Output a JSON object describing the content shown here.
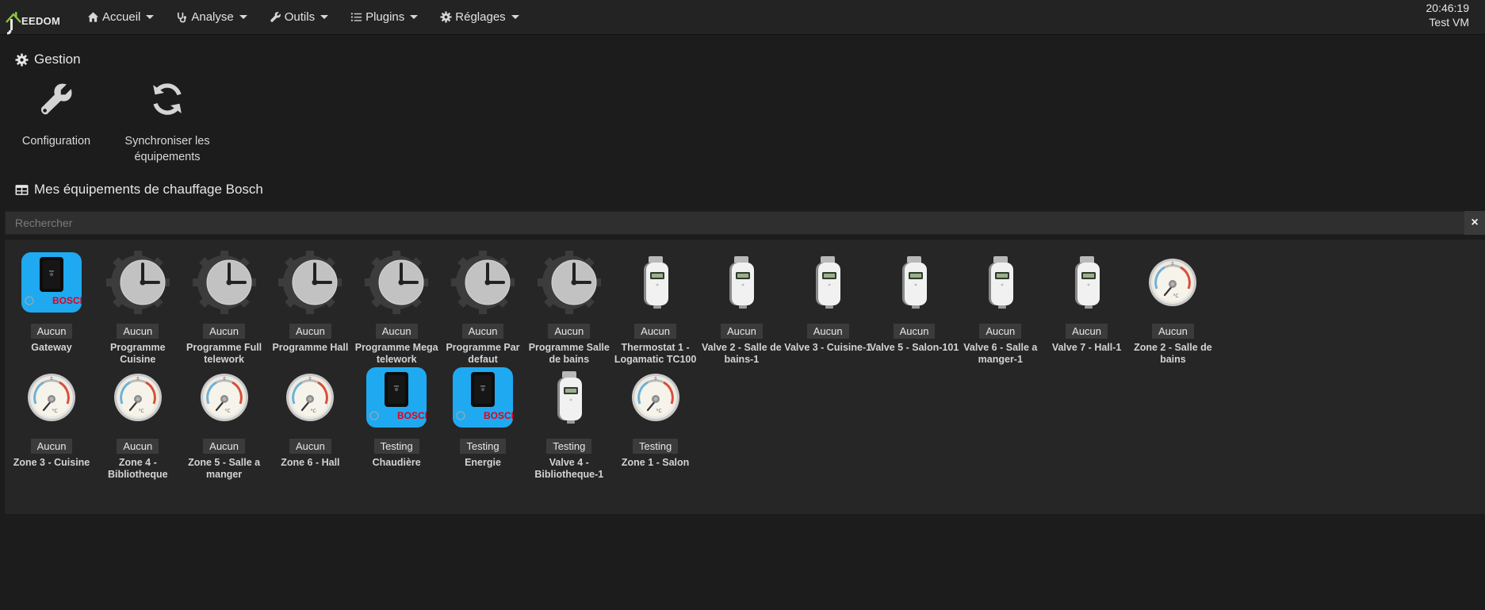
{
  "app": {
    "logo_text": "EEDOM"
  },
  "nav": {
    "items": [
      {
        "label": "Accueil",
        "icon": "home-icon"
      },
      {
        "label": "Analyse",
        "icon": "stethoscope-icon"
      },
      {
        "label": "Outils",
        "icon": "wrench-icon"
      },
      {
        "label": "Plugins",
        "icon": "list-icon"
      },
      {
        "label": "Réglages",
        "icon": "gear-icon"
      }
    ],
    "clock": "20:46:19",
    "host": "Test VM"
  },
  "gestion": {
    "title": "Gestion",
    "items": [
      {
        "label": "Configuration",
        "icon": "wrench-icon"
      },
      {
        "label": "Synchroniser les équipements",
        "icon": "refresh-icon"
      }
    ]
  },
  "equipements": {
    "title": "Mes équipements de chauffage Bosch",
    "search_placeholder": "Rechercher",
    "clear_label": "×",
    "devices": [
      {
        "name": "Gateway",
        "badge": "Aucun",
        "icon": "bosch-gateway-icon"
      },
      {
        "name": "Programme Cuisine",
        "badge": "Aucun",
        "icon": "schedule-clock-icon"
      },
      {
        "name": "Programme Full telework",
        "badge": "Aucun",
        "icon": "schedule-clock-icon"
      },
      {
        "name": "Programme Hall",
        "badge": "Aucun",
        "icon": "schedule-clock-icon"
      },
      {
        "name": "Programme Mega telework",
        "badge": "Aucun",
        "icon": "schedule-clock-icon"
      },
      {
        "name": "Programme Par defaut",
        "badge": "Aucun",
        "icon": "schedule-clock-icon"
      },
      {
        "name": "Programme Salle de bains",
        "badge": "Aucun",
        "icon": "schedule-clock-icon"
      },
      {
        "name": "Thermostat 1 - Logamatic TC100",
        "badge": "Aucun",
        "icon": "radiator-valve-icon"
      },
      {
        "name": "Valve 2 - Salle de bains-1",
        "badge": "Aucun",
        "icon": "radiator-valve-icon"
      },
      {
        "name": "Valve 3 - Cuisine-1",
        "badge": "Aucun",
        "icon": "radiator-valve-icon"
      },
      {
        "name": "Valve 5 - Salon-101",
        "badge": "Aucun",
        "icon": "radiator-valve-icon"
      },
      {
        "name": "Valve 6 - Salle a manger-1",
        "badge": "Aucun",
        "icon": "radiator-valve-icon"
      },
      {
        "name": "Valve 7 - Hall-1",
        "badge": "Aucun",
        "icon": "radiator-valve-icon"
      },
      {
        "name": "Zone 2 - Salle de bains",
        "badge": "Aucun",
        "icon": "thermometer-gauge-icon"
      },
      {
        "name": "Zone 3 - Cuisine",
        "badge": "Aucun",
        "icon": "thermometer-gauge-icon"
      },
      {
        "name": "Zone 4 - Bibliotheque",
        "badge": "Aucun",
        "icon": "thermometer-gauge-icon"
      },
      {
        "name": "Zone 5 - Salle a manger",
        "badge": "Aucun",
        "icon": "thermometer-gauge-icon"
      },
      {
        "name": "Zone 6 - Hall",
        "badge": "Aucun",
        "icon": "thermometer-gauge-icon"
      },
      {
        "name": "Chaudière",
        "badge": "Testing",
        "icon": "bosch-gateway-icon"
      },
      {
        "name": "Energie",
        "badge": "Testing",
        "icon": "bosch-gateway-icon"
      },
      {
        "name": "Valve 4 - Bibliotheque-1",
        "badge": "Testing",
        "icon": "radiator-valve-icon"
      },
      {
        "name": "Zone 1 - Salon",
        "badge": "Testing",
        "icon": "thermometer-gauge-icon"
      }
    ]
  },
  "colors": {
    "background": "#1c1c1c",
    "navbar": "#232323",
    "panel": "#262626",
    "bosch_blue": "#1fa9f0",
    "bosch_red": "#e2001a",
    "badge": "#3b3b3b"
  }
}
